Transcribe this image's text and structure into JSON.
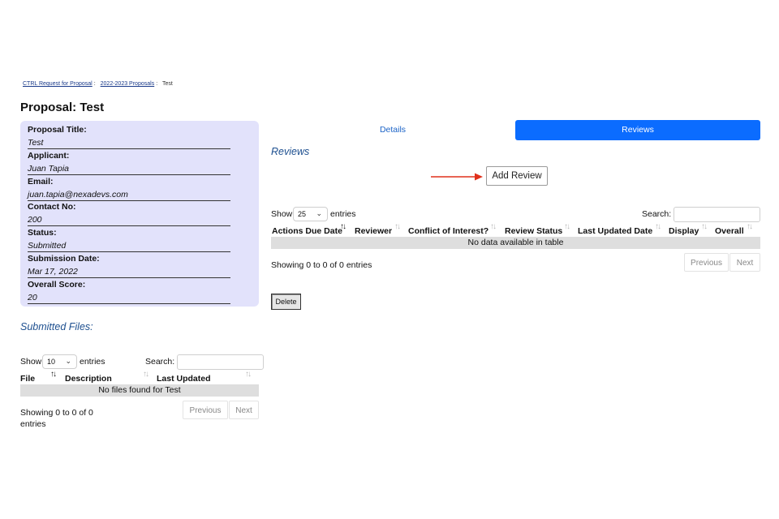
{
  "breadcrumb": {
    "items": [
      "CTRL Request for Proposal",
      "2022-2023 Proposals"
    ],
    "current": "Test",
    "separator": ":"
  },
  "page": {
    "title": "Proposal: Test"
  },
  "proposal": {
    "fields": [
      {
        "label": "Proposal Title:",
        "value": "Test"
      },
      {
        "label": "Applicant:",
        "value": "Juan Tapia"
      },
      {
        "label": "Email:",
        "value": "juan.tapia@nexadevs.com"
      },
      {
        "label": "Contact No:",
        "value": "200"
      },
      {
        "label": "Status:",
        "value": "Submitted"
      },
      {
        "label": "Submission Date:",
        "value": "Mar 17, 2022"
      },
      {
        "label": "Overall Score:",
        "value": "20"
      }
    ]
  },
  "files": {
    "heading": "Submitted Files:",
    "show_label": "Show",
    "page_size": "10",
    "entries_label": "entries",
    "search_label": "Search:",
    "search_value": "",
    "columns": [
      "File",
      "Description",
      "Last Updated"
    ],
    "empty_message": "No files found for Test",
    "info_line1": "Showing 0 to 0 of 0",
    "info_line2": "entries",
    "prev_label": "Previous",
    "next_label": "Next"
  },
  "tabs": [
    {
      "label": "Details",
      "active": false
    },
    {
      "label": "Reviews",
      "active": true
    }
  ],
  "reviews": {
    "heading": "Reviews",
    "add_button": "Add Review",
    "show_label": "Show",
    "page_size": "25",
    "entries_label": "entries",
    "search_label": "Search:",
    "search_value": "",
    "columns": [
      "Actions Due Date",
      "Reviewer",
      "Conflict of Interest?",
      "Review Status",
      "Last Updated Date",
      "Display",
      "Overall"
    ],
    "empty_message": "No data available in table",
    "info": "Showing 0 to 0 of 0 entries",
    "prev_label": "Previous",
    "next_label": "Next",
    "delete_button": "Delete"
  },
  "colors": {
    "accent": "#0b6cff",
    "card_bg": "#e2e2fb",
    "heading": "#1d4f8f",
    "annotation_arrow": "#e0311c"
  }
}
